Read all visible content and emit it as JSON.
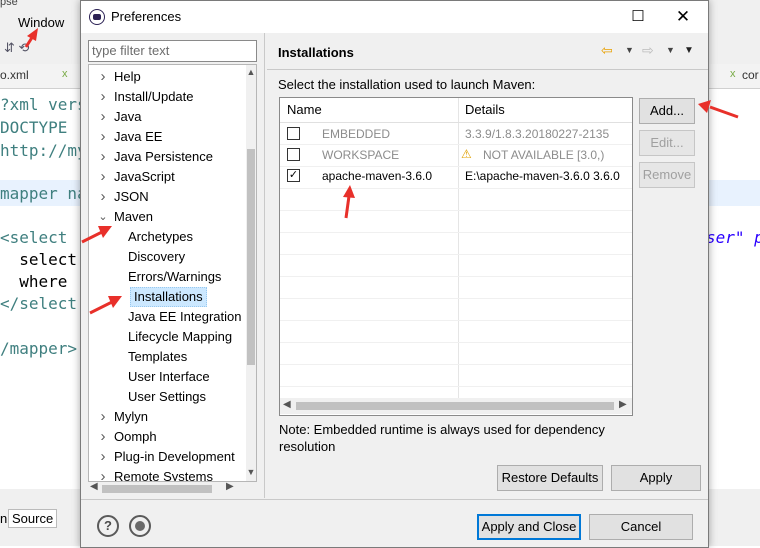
{
  "background": {
    "menu": {
      "window_label": "Window",
      "partial_app": "pse"
    },
    "tabs": {
      "left_tab": "o.xml",
      "right_tab": "cor"
    },
    "editor_lines": [
      "?xml vers",
      "DOCTYPE",
      "http://my",
      "mapper na",
      "<select",
      "  select",
      "  where",
      "</select",
      "/mapper>"
    ],
    "editor_right_text": "ser\" p",
    "bottom_tabs": {
      "left": "n",
      "source": "Source"
    }
  },
  "dialog": {
    "title": "Preferences",
    "filter_placeholder": "type filter text",
    "tree": [
      {
        "label": "Help",
        "expanded": false
      },
      {
        "label": "Install/Update",
        "expanded": false
      },
      {
        "label": "Java",
        "expanded": false
      },
      {
        "label": "Java EE",
        "expanded": false
      },
      {
        "label": "Java Persistence",
        "expanded": false
      },
      {
        "label": "JavaScript",
        "expanded": false
      },
      {
        "label": "JSON",
        "expanded": false
      },
      {
        "label": "Maven",
        "expanded": true
      },
      {
        "label": "Archetypes"
      },
      {
        "label": "Discovery"
      },
      {
        "label": "Errors/Warnings"
      },
      {
        "label": "Installations",
        "selected": true
      },
      {
        "label": "Java EE Integration"
      },
      {
        "label": "Lifecycle Mapping"
      },
      {
        "label": "Templates"
      },
      {
        "label": "User Interface"
      },
      {
        "label": "User Settings"
      },
      {
        "label": "Mylyn",
        "expanded": false
      },
      {
        "label": "Oomph",
        "expanded": false
      },
      {
        "label": "Plug-in Development",
        "expanded": false
      },
      {
        "label": "Remote Systems",
        "expanded": false
      }
    ],
    "page_title": "Installations",
    "description": "Select the installation used to launch Maven:",
    "table": {
      "headers": [
        "Name",
        "Details"
      ],
      "rows": [
        {
          "checked": false,
          "name": "EMBEDDED",
          "details": "3.3.9/1.8.3.20180227-2135",
          "disabled": true,
          "warning": false
        },
        {
          "checked": false,
          "name": "WORKSPACE",
          "details": "NOT AVAILABLE [3.0,)",
          "disabled": true,
          "warning": true
        },
        {
          "checked": true,
          "name": "apache-maven-3.6.0",
          "details": "E:\\apache-maven-3.6.0 3.6.0",
          "disabled": false,
          "warning": false
        }
      ]
    },
    "buttons": {
      "add": "Add...",
      "edit": "Edit...",
      "remove": "Remove",
      "restore": "Restore Defaults",
      "apply": "Apply",
      "apply_close": "Apply and Close",
      "cancel": "Cancel"
    },
    "note": "Note: Embedded runtime is always used for dependency resolution"
  },
  "colors": {
    "selection": "#cce8ff",
    "annotation_arrow": "#e8302a",
    "default_button_border": "#0078d7"
  }
}
